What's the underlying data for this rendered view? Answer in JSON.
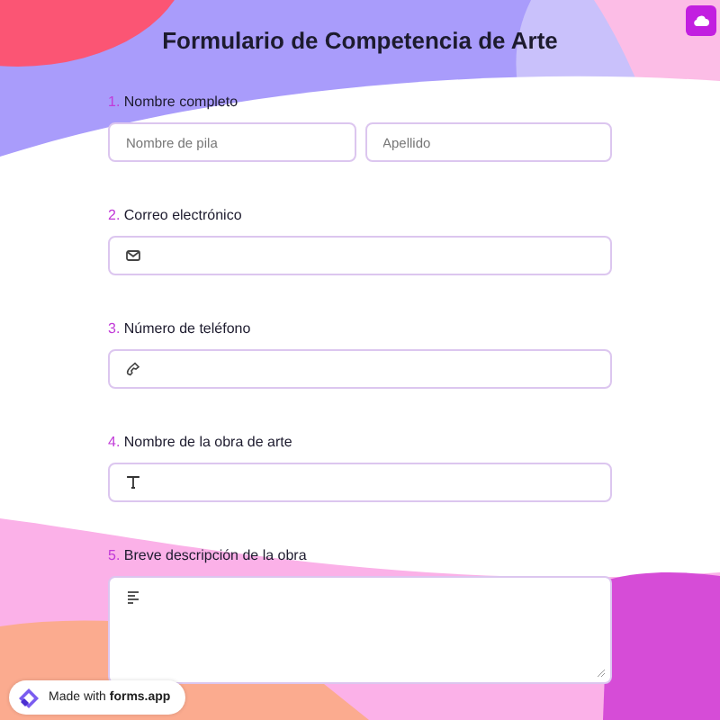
{
  "title": "Formulario de Competencia de Arte",
  "questions": [
    {
      "number": "1.",
      "label": "Nombre completo",
      "kind": "name",
      "placeholders": [
        "Nombre de pila",
        "Apellido"
      ]
    },
    {
      "number": "2.",
      "label": "Correo electrónico",
      "kind": "email"
    },
    {
      "number": "3.",
      "label": "Número de teléfono",
      "kind": "phone"
    },
    {
      "number": "4.",
      "label": "Nombre de la obra de arte",
      "kind": "text"
    },
    {
      "number": "5.",
      "label": "Breve descripción de la obra",
      "kind": "textarea"
    }
  ],
  "badge": "Made with **forms.app**"
}
